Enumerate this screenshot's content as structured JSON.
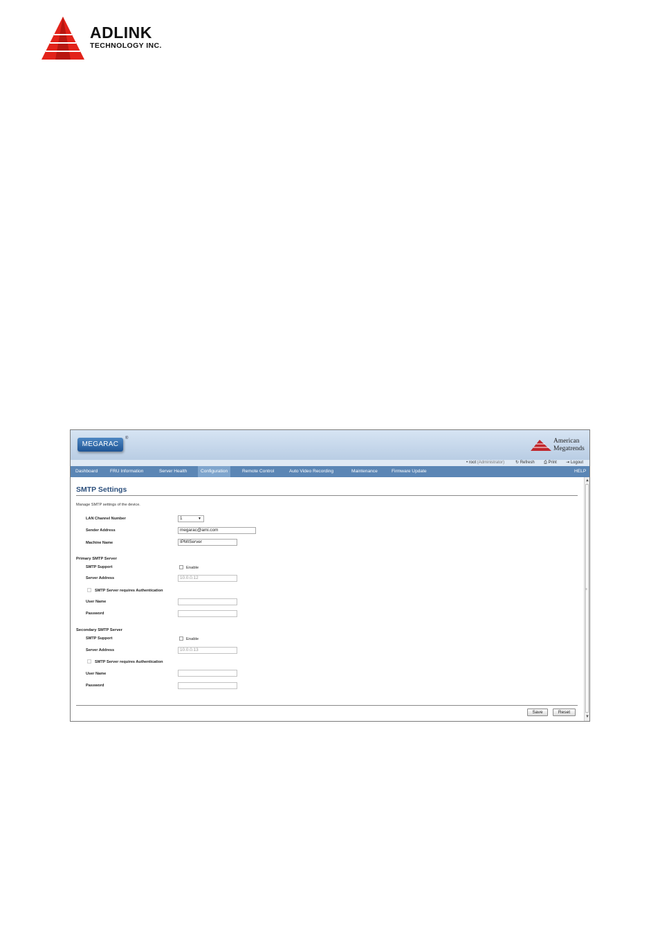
{
  "doc_header": {
    "brand": "ADLINK",
    "brand_sub": "TECHNOLOGY INC."
  },
  "app": {
    "product_logo": "MEGARAC",
    "registered_mark": "®",
    "vendor_line1": "American",
    "vendor_line2": "Megatrends"
  },
  "userbar": {
    "user": "root",
    "role": "(Administrator)",
    "refresh": "Refresh",
    "print": "Print",
    "logout": "Logout"
  },
  "nav": {
    "items": [
      {
        "label": "Dashboard"
      },
      {
        "label": "FRU Information"
      },
      {
        "label": "Server Health"
      },
      {
        "label": "Configuration",
        "active": true
      },
      {
        "label": "Remote Control"
      },
      {
        "label": "Auto Video Recording"
      },
      {
        "label": "Maintenance"
      },
      {
        "label": "Firmware Update"
      }
    ],
    "help": "HELP"
  },
  "page": {
    "title": "SMTP Settings",
    "description": "Manage SMTP settings of the device."
  },
  "form": {
    "lan_channel": {
      "label": "LAN Channel Number",
      "value": "1"
    },
    "sender_address": {
      "label": "Sender Address",
      "value": "megarac@ami.com"
    },
    "machine_name": {
      "label": "Machine Name",
      "value": "IPMIServer"
    },
    "primary": {
      "heading": "Primary SMTP Server",
      "smtp_support_label": "SMTP Support",
      "enable_label": "Enable",
      "server_address_label": "Server Address",
      "server_address_value": "10.0.0.12",
      "auth_label": "SMTP Server requires Authentication",
      "username_label": "User Name",
      "username_value": "",
      "password_label": "Password",
      "password_value": ""
    },
    "secondary": {
      "heading": "Secondary SMTP Server",
      "smtp_support_label": "SMTP Support",
      "enable_label": "Enable",
      "server_address_label": "Server Address",
      "server_address_value": "10.0.0.13",
      "auth_label": "SMTP Server requires Authentication",
      "username_label": "User Name",
      "username_value": "",
      "password_label": "Password",
      "password_value": ""
    }
  },
  "buttons": {
    "save": "Save",
    "reset": "Reset"
  },
  "colors": {
    "nav_bg": "#5b86b5",
    "nav_active": "#7fa5cd",
    "banner_top": "#d6e4f3",
    "title": "#2c4f7c",
    "logo_red": "#e2231a"
  }
}
